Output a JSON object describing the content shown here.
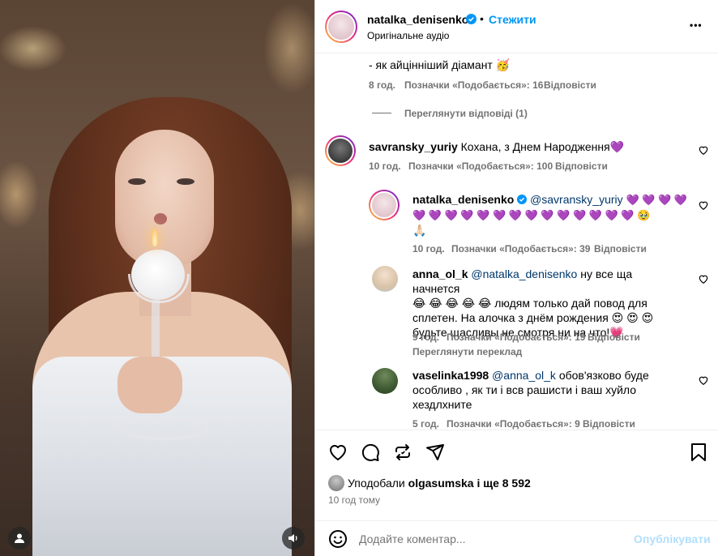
{
  "post": {
    "author": "natalka_denisenko",
    "follow_label": "Стежити",
    "subtitle": "Оригінальне аудіо",
    "more_label": "•••",
    "dot": "•"
  },
  "comments": {
    "top_fragment": {
      "text": "- як айцінніший діамант 🥳",
      "time": "8 год.",
      "likes": "Позначки «Подобається»: 16",
      "reply": "Відповісти"
    },
    "view_replies": "Переглянути відповіді (1)",
    "c1": {
      "user": "savransky_yuriy",
      "text": "Кохана, з Днем Народження💜",
      "time": "10 год.",
      "likes": "Позначки «Подобається»: 100",
      "reply": "Відповісти"
    },
    "r1": {
      "user": "natalka_denisenko",
      "mention": "@savransky_yuriy",
      "hearts_line1": "💜 💜 💜 💜",
      "hearts_line2": "💜 💜 💜 💜 💜 💜 💜 💜 💜 💜 💜 💜 💜 💜 🥹",
      "line3": "🙏🏻",
      "time": "10 год.",
      "likes": "Позначки «Подобається»: 39",
      "reply": "Відповісти"
    },
    "r2": {
      "user": "anna_ol_k",
      "mention": "@natalka_denisenko",
      "text1": "ну все ща начнется",
      "text2": "😂 😂 😂 😂 😂 людям только дай повод для",
      "text3": "сплетен. На алочка з днём рождения 😍 😍 😍",
      "text4": "будьте щасливы не смотря ни на что!💗",
      "time": "9 год.",
      "likes": "Позначки «Подобається»: 19",
      "reply": "Відповісти",
      "translate": "Переглянути переклад"
    },
    "r3": {
      "user": "vaselinka1998",
      "mention": "@anna_ol_k",
      "text1": "обов'язково буде",
      "text2": "особливо , як ти і всв рашисти і ваш хуйло",
      "text3": "хездлхните",
      "time": "5 год.",
      "likes": "Позначки «Подобається»: 9",
      "reply": "Відповісти"
    }
  },
  "likes_summary": {
    "prefix": "Уподобали",
    "user": "olgasumska",
    "suffix": "і ще 8 592",
    "time": "10 год тому"
  },
  "composer": {
    "placeholder": "Додайте коментар...",
    "post_label": "Опублікувати"
  },
  "colors": {
    "accent": "#0095f6",
    "link": "#00376b",
    "muted": "#737373",
    "verified": "#0095f6"
  }
}
